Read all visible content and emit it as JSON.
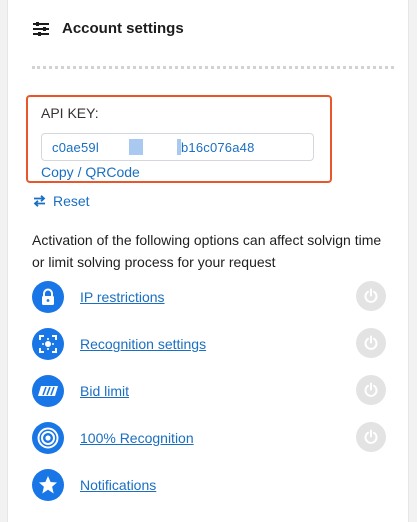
{
  "header": {
    "title": "Account settings",
    "icon": "sliders-icon"
  },
  "api": {
    "label": "API KEY:",
    "key_prefix": "c0ae59l",
    "key_suffix": "b16c076a48",
    "copy_label": "Copy",
    "separator": " / ",
    "qr_label": "QRCode",
    "highlight_color": "#e8562a"
  },
  "reset": {
    "label": "Reset",
    "icon": "swap-arrows-icon"
  },
  "description": "Activation of the following options can affect solvign time or limit solving process for your request",
  "options": [
    {
      "label": "IP restrictions",
      "icon": "lock-icon",
      "toggle": "power-icon"
    },
    {
      "label": "Recognition settings",
      "icon": "focus-icon",
      "toggle": "power-icon"
    },
    {
      "label": "Bid limit",
      "icon": "speed-icon",
      "toggle": "power-icon"
    },
    {
      "label": "100% Recognition",
      "icon": "target-icon",
      "toggle": "power-icon"
    },
    {
      "label": "Notifications",
      "icon": "star-icon"
    }
  ],
  "colors": {
    "accent": "#1976e6",
    "link": "#1a6fc2",
    "toggle_off": "#e3e3e3"
  }
}
